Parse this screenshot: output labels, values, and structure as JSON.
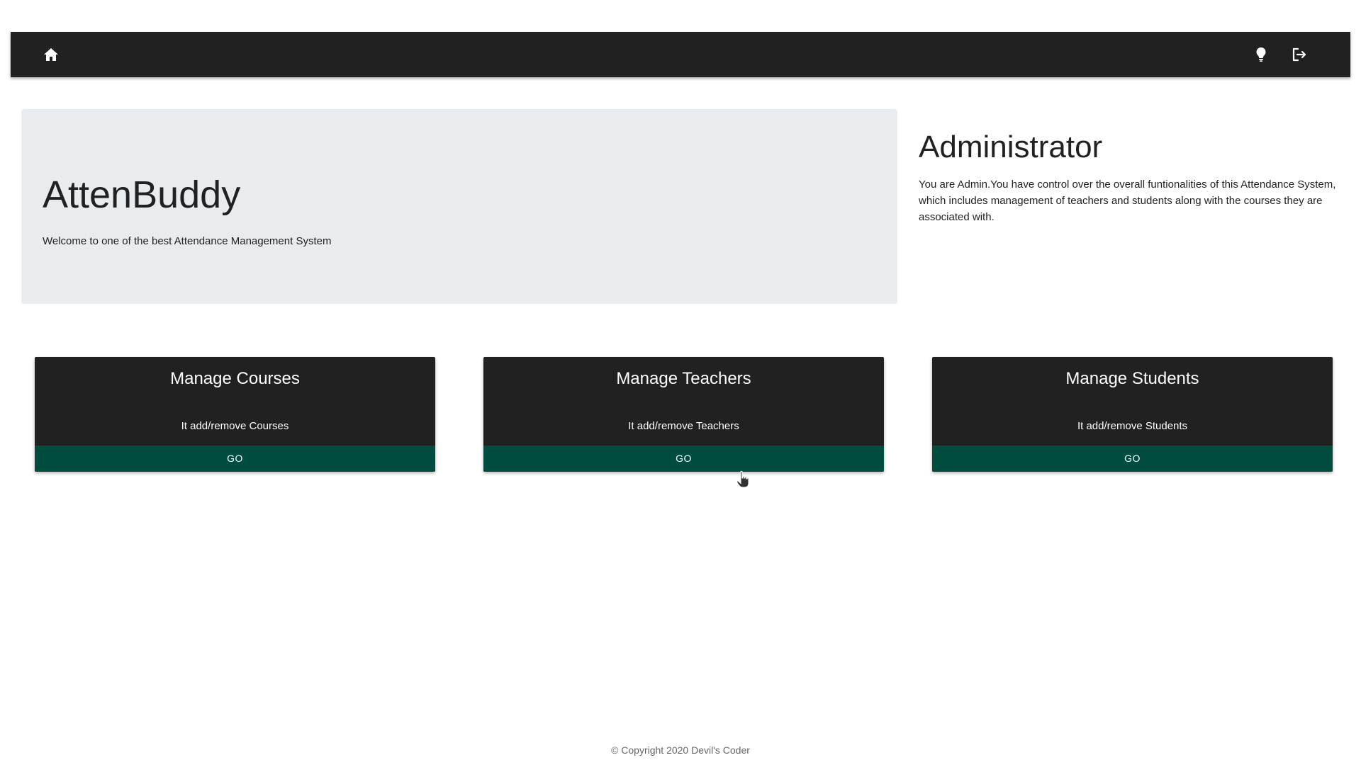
{
  "navbar": {
    "icons": {
      "home": "home-icon",
      "theme": "lightbulb-icon",
      "logout": "logout-icon"
    }
  },
  "jumbotron": {
    "title": "AttenBuddy",
    "text": "Welcome to one of the best Attendance Management System"
  },
  "admin": {
    "title": "Administrator",
    "text": "You are Admin.You have control over the overall funtionalities of this Attendance System, which includes management of teachers and students along with the courses they are associated with."
  },
  "cards": [
    {
      "title": "Manage Courses",
      "text": "It add/remove Courses",
      "button": "GO"
    },
    {
      "title": "Manage Teachers",
      "text": "It add/remove Teachers",
      "button": "GO"
    },
    {
      "title": "Manage Students",
      "text": "It add/remove Students",
      "button": "GO"
    }
  ],
  "footer": {
    "copyright": "© Copyright 2020 Devil's Coder"
  },
  "colors": {
    "navbar_bg": "#212121",
    "jumbotron_bg": "#e9ecef",
    "card_bg": "#212121",
    "button_bg": "#004d40",
    "footer_text": "#666666"
  }
}
